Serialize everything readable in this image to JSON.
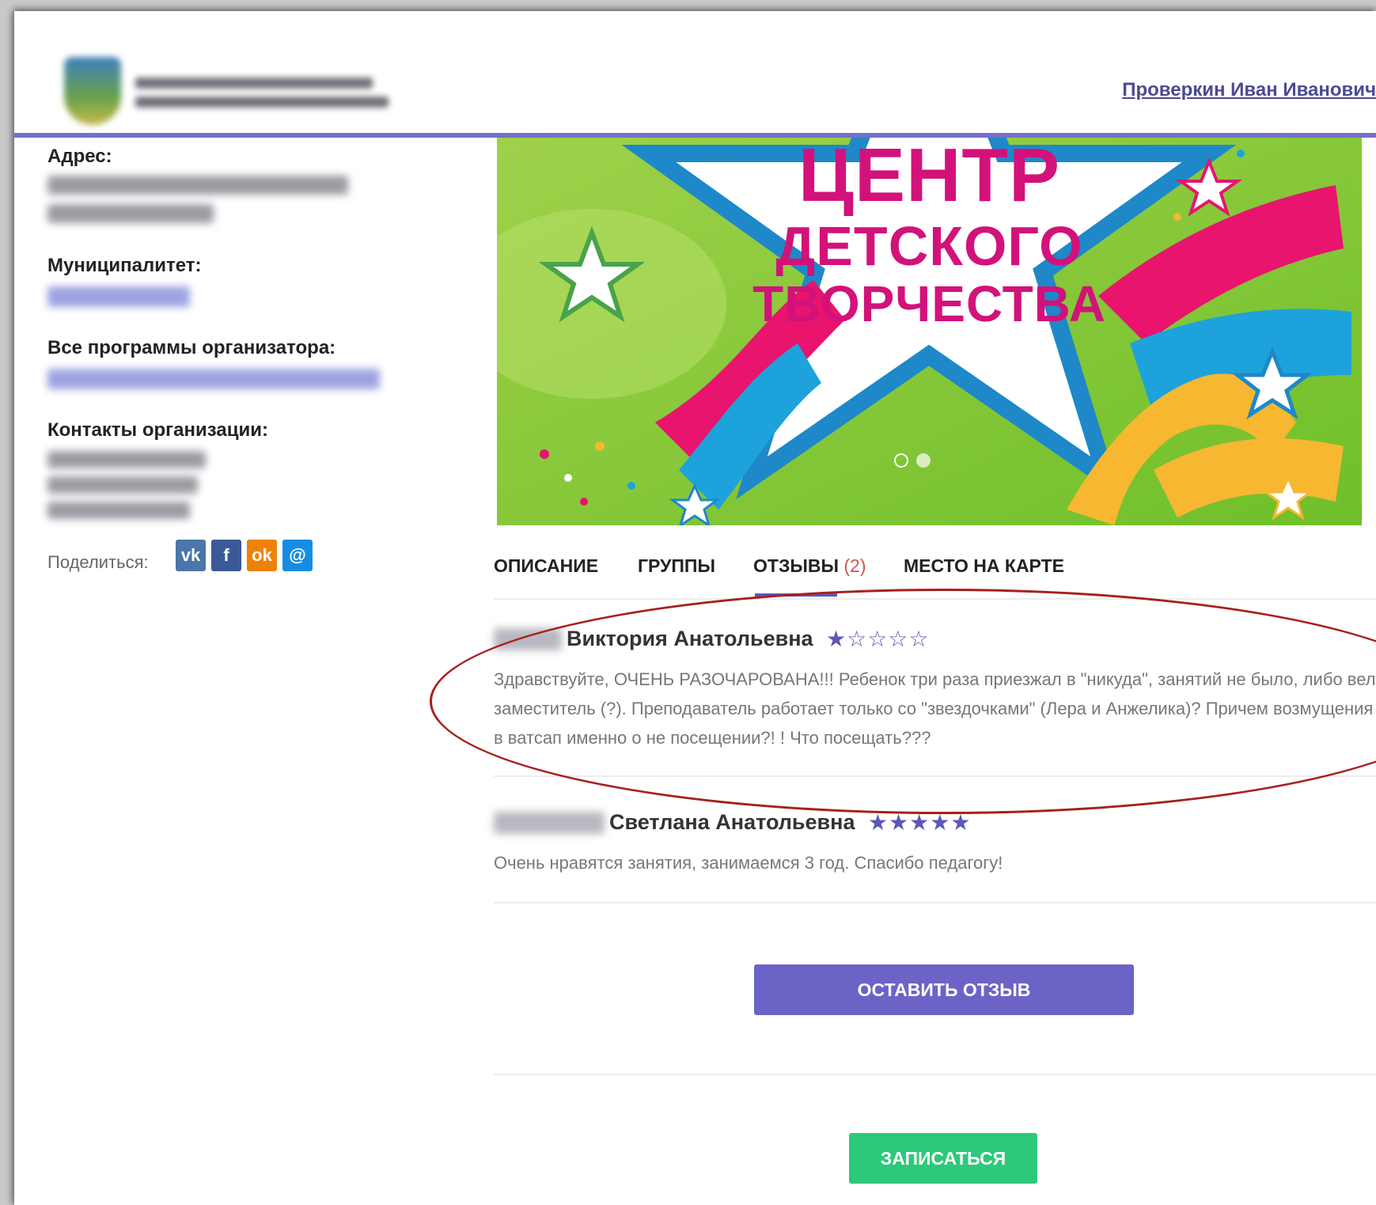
{
  "header": {
    "user_name": "Проверкин Иван Иванович"
  },
  "sidebar": {
    "address_label": "Адрес:",
    "municipality_label": "Муниципалитет:",
    "all_programs_label": "Все программы организатора:",
    "contacts_label": "Контакты организации:",
    "share_label": "Поделиться:",
    "share_buttons": [
      "vk-icon",
      "facebook-icon",
      "odnoklassniki-icon",
      "moimir-icon"
    ]
  },
  "banner": {
    "line1": "ЦЕНТР",
    "line2": "ДЕТСКОГО",
    "line3": "ТВОРЧЕСТВА"
  },
  "tabs": {
    "description": "ОПИСАНИЕ",
    "groups": "ГРУППЫ",
    "reviews": "ОТЗЫВЫ",
    "reviews_count": "(2)",
    "map": "МЕСТО НА КАРТЕ",
    "active": "reviews"
  },
  "reviews": [
    {
      "name": "Виктория Анатольевна",
      "rating": 1,
      "max_rating": 5,
      "text": "Здравствуйте, ОЧЕНЬ РАЗОЧАРОВАНА!!! Ребенок три раза приезжал в \"никуда\", занятий не было, либо вел заместитель (?). Преподаватель работает только со \"звездочками\" (Лера и Анжелика)? Причем возмущения в ватсап именно о не посещении?! ! Что посещать???"
    },
    {
      "name": "Светлана Анатольевна",
      "rating": 5,
      "max_rating": 5,
      "text": "Очень нравятся занятия, занимаемся 3 год. Спасибо педагогу!"
    }
  ],
  "buttons": {
    "leave_review": "ОСТАВИТЬ ОТЗЫВ",
    "enroll": "ЗАПИСАТЬСЯ"
  },
  "colors": {
    "accent": "#6c63c7",
    "header_rule": "#7470c9",
    "enroll": "#2ec87b",
    "annotation": "#a6201c",
    "banner_green": "#8cc63f",
    "banner_title": "#d2127a"
  }
}
